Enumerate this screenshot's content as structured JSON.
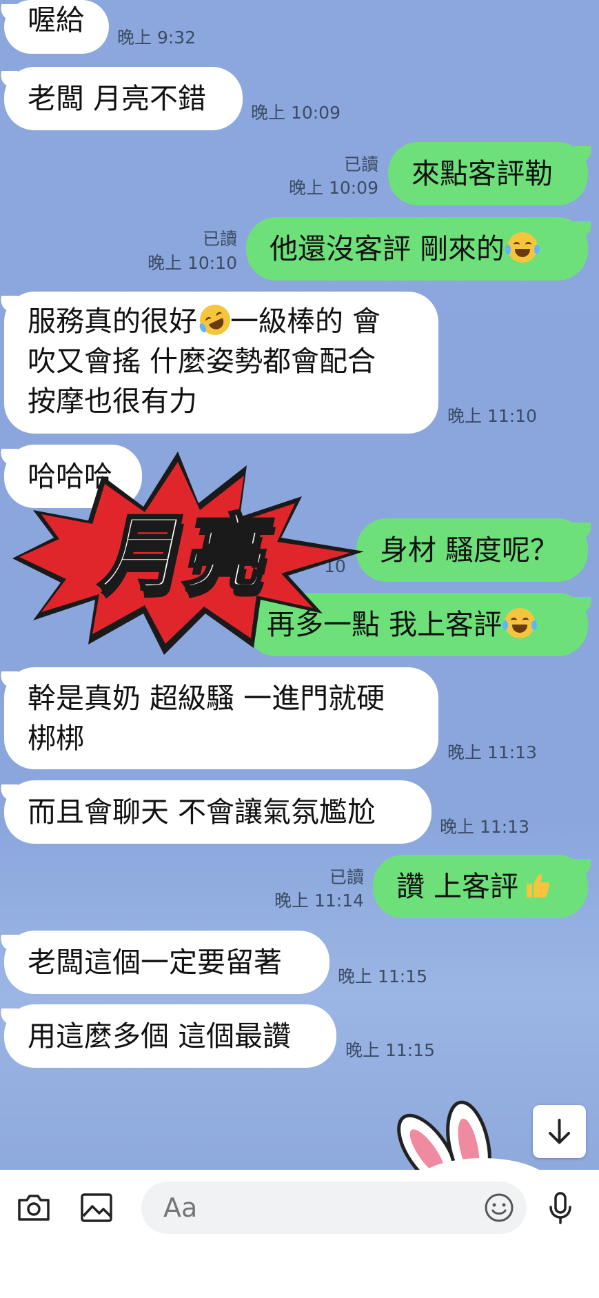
{
  "messages": [
    {
      "side": "in",
      "text": "喔給",
      "time": "晚上 9:32"
    },
    {
      "side": "in",
      "text": "老闆 月亮不錯",
      "time": "晚上 10:09"
    },
    {
      "side": "out",
      "text": "來點客評勒",
      "read": "已讀",
      "time": "晚上 10:09"
    },
    {
      "side": "out",
      "text": "他還沒客評 剛來的",
      "emoji": "laughing-tears",
      "read": "已讀",
      "time": "晚上 10:10"
    },
    {
      "side": "in",
      "lines": [
        "服務真的很好",
        "一級棒的 會",
        "吹又會搖 什麼姿勢都會配合",
        "按摩也很有力"
      ],
      "emoji": "rolling-laugh",
      "time": "晚上 11:10"
    },
    {
      "side": "in",
      "text": "哈哈哈",
      "time": ""
    },
    {
      "side": "out",
      "text": "身材 騷度呢？",
      "read": "",
      "time": "10"
    },
    {
      "side": "out",
      "text": "再多一點 我上客評",
      "emoji": "laughing-tears",
      "read": "",
      "time": ""
    },
    {
      "side": "in",
      "lines": [
        "幹是真奶 超級騷 一進門就硬",
        "梆梆"
      ],
      "time": "晚上 11:13"
    },
    {
      "side": "in",
      "text": "而且會聊天 不會讓氣氛尷尬",
      "time": "晚上 11:13"
    },
    {
      "side": "out",
      "text": "讚 上客評",
      "emoji": "thumbs-up",
      "read": "已讀",
      "time": "晚上 11:14"
    },
    {
      "side": "in",
      "text": "老闆這個一定要留著",
      "time": "晚上 11:15"
    },
    {
      "side": "in",
      "text": "用這麼多個 這個最讚",
      "time": "晚上 11:15"
    }
  ],
  "overlay_sticker": {
    "text": "月亮",
    "color": "#e0262b"
  },
  "input": {
    "placeholder": "Aa"
  },
  "icons": {
    "camera": "camera-icon",
    "gallery": "image-icon",
    "emoji": "smiley-icon",
    "mic": "microphone-icon",
    "scroll": "arrow-down-icon"
  },
  "colors": {
    "background": "#8aa6dc",
    "incoming": "#ffffff",
    "outgoing": "#6ee07a"
  }
}
